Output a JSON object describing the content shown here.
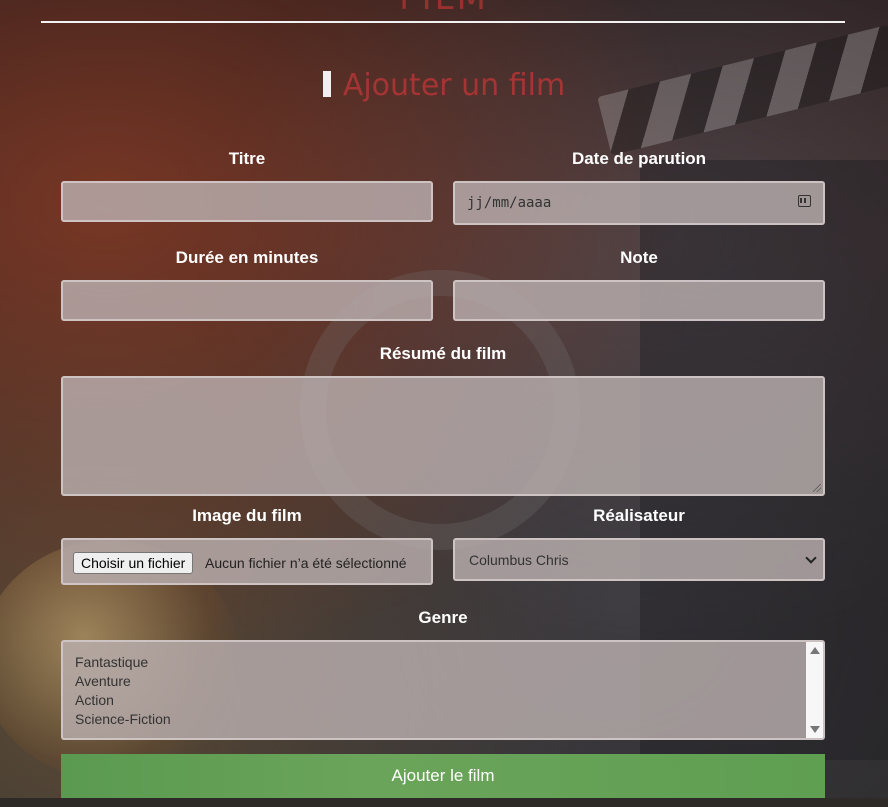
{
  "header": {
    "site_title": "FILM",
    "heading": "Ajouter un film"
  },
  "form": {
    "titre_label": "Titre",
    "titre_value": "",
    "date_label": "Date de parution",
    "date_placeholder": "jj/mm/aaaa",
    "duree_label": "Durée en minutes",
    "duree_value": "",
    "note_label": "Note",
    "note_value": "",
    "resume_label": "Résumé du film",
    "resume_value": "",
    "image_label": "Image du film",
    "file_button": "Choisir un fichier",
    "file_status": "Aucun fichier n’a été sélectionné",
    "realisateur_label": "Réalisateur",
    "realisateur_selected": "Columbus Chris",
    "genre_label": "Genre",
    "genres": [
      "Fantastique",
      "Aventure",
      "Action",
      "Science-Fiction"
    ],
    "submit_label": "Ajouter le film"
  },
  "colors": {
    "heading": "#a63434",
    "submit": "#5f9f52"
  },
  "icons": {
    "date": "calendar-icon",
    "select": "chevron-down-icon",
    "scroll_up": "scroll-up-icon",
    "scroll_down": "scroll-down-icon"
  }
}
